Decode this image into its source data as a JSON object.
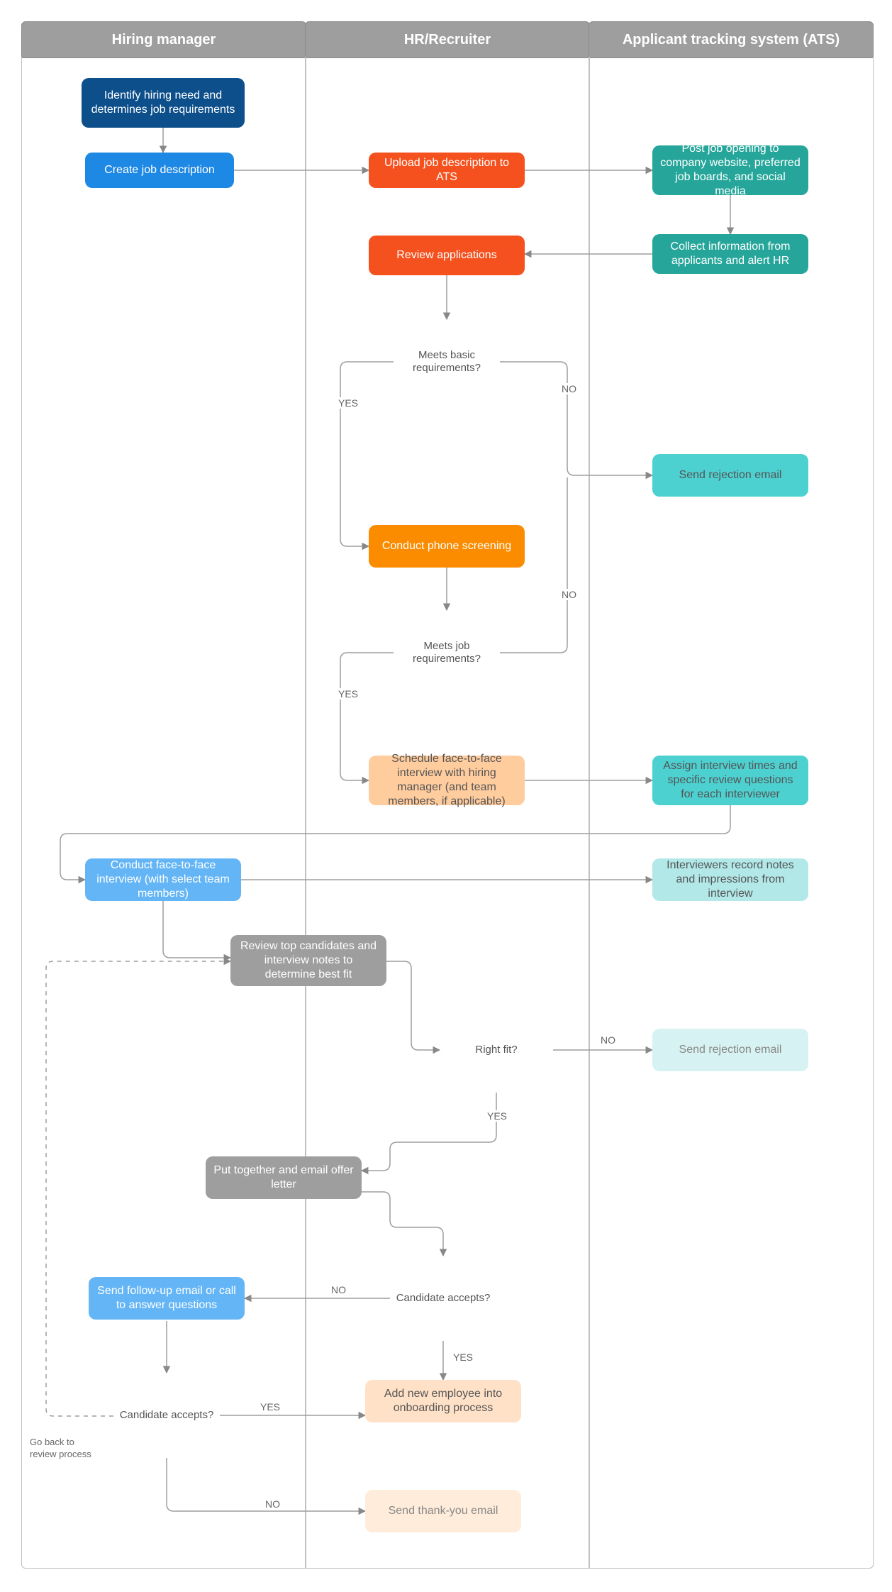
{
  "lanes": {
    "hm": "Hiring manager",
    "hr": "HR/Recruiter",
    "ats": "Applicant tracking system (ATS)"
  },
  "nodes": {
    "identify": "Identify hiring need and determines job requirements",
    "create_jd": "Create job description",
    "upload_jd": "Upload job description to ATS",
    "post_job": "Post job opening to company website, preferred job boards, and social media",
    "collect_info": "Collect information from applicants and alert HR",
    "review_apps": "Review applications",
    "meets_basic": "Meets basic requirements?",
    "send_reject1": "Send rejection email",
    "phone_screen": "Conduct phone screening",
    "meets_job": "Meets job requirements?",
    "schedule_f2f": "Schedule face-to-face interview with hiring manager (and team members, if applicable)",
    "assign_times": "Assign interview times and specific review questions for each interviewer",
    "conduct_f2f": "Conduct face-to-face interview (with select team members)",
    "record_notes": "Interviewers record notes and impressions from interview",
    "review_top": "Review top candidates and interview notes to determine best fit",
    "right_fit": "Right fit?",
    "send_reject2": "Send rejection email",
    "offer_letter": "Put together and email offer letter",
    "cand_accepts1": "Candidate accepts?",
    "followup": "Send follow-up email or call to answer questions",
    "cand_accepts2": "Candidate accepts?",
    "onboarding": "Add new employee into onboarding process",
    "thank_you": "Send thank-you email",
    "go_back": "Go back to\nreview process"
  },
  "labels": {
    "yes": "YES",
    "no": "NO"
  }
}
